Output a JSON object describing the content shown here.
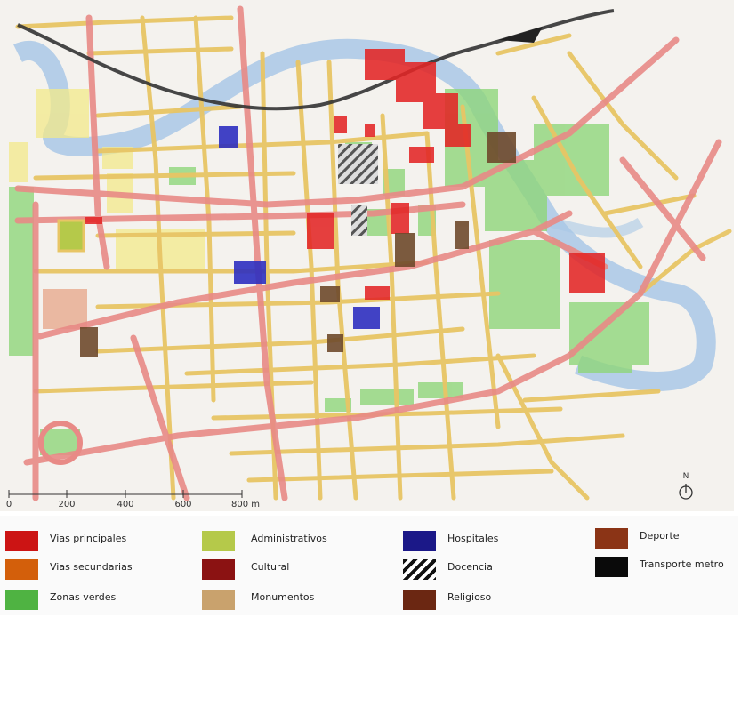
{
  "scale_bar": {
    "ticks": [
      "0",
      "200",
      "400",
      "600",
      "800 m"
    ]
  },
  "north_arrow": {
    "label": "N"
  },
  "legend": {
    "items": [
      {
        "label": "Vias principales",
        "color": "#cc1414",
        "pattern": "solid"
      },
      {
        "label": "Vias secundarias",
        "color": "#d35f0b",
        "pattern": "solid"
      },
      {
        "label": "Zonas verdes",
        "color": "#4fb342",
        "pattern": "solid"
      },
      {
        "label": "Administrativos",
        "color": "#b5c94a",
        "pattern": "solid"
      },
      {
        "label": "Cultural",
        "color": "#8b1212",
        "pattern": "solid"
      },
      {
        "label": "Monumentos",
        "color": "#c9a26d",
        "pattern": "solid"
      },
      {
        "label": "Hospitales",
        "color": "#1b1888",
        "pattern": "solid"
      },
      {
        "label": "Docencia",
        "color": "#111111",
        "pattern": "hatch"
      },
      {
        "label": "Religioso",
        "color": "#6b2712",
        "pattern": "solid"
      },
      {
        "label": "Deporte",
        "color": "#8b3416",
        "pattern": "solid"
      },
      {
        "label": "Transporte metro",
        "color": "#0a0a0a",
        "pattern": "solid"
      }
    ]
  }
}
